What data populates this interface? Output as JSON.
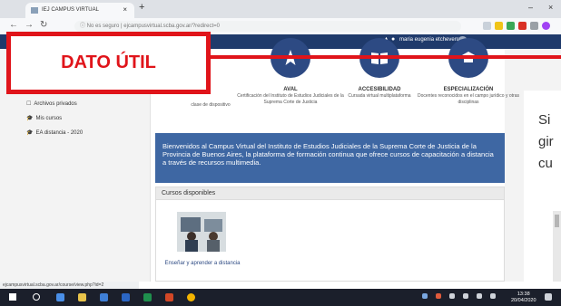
{
  "browser": {
    "tab_title": "IEJ CAMPUS VIRTUAL",
    "tab_close": "×",
    "new_tab": "+",
    "win_min": "–",
    "win_close": "×",
    "address": "ⓘ No es seguro  |  ejcampusvirtual.scba.gov.ar/?redirect=0"
  },
  "site": {
    "user_name": "maria eugenia etcheverr",
    "status_url": "ejcampusvirtual.scba.gov.ar/course/view.php?id=2"
  },
  "nav": {
    "items": [
      {
        "icon": "☐",
        "label": "Archivos privados"
      },
      {
        "icon": "🎓",
        "label": "Mis cursos"
      },
      {
        "icon": "🎓",
        "label": "EA distancia - 2020"
      }
    ]
  },
  "features": [
    {
      "title": "",
      "desc": "clase de dispositivo"
    },
    {
      "title": "AVAL",
      "desc": "Certificación del Instituto de Estudios Judiciales de la Suprema Corte de Justicia"
    },
    {
      "title": "ACCESIBILIDAD",
      "desc": "Cursada virtual multiplataforma"
    },
    {
      "title": "ESPECIALIZACIÓN",
      "desc": "Docentes reconocidos en el campo jurídico y otras disciplinas"
    }
  ],
  "welcome": {
    "text": "Bienvenidos al Campus Virtual del Instituto de Estudios Judiciales de la Suprema Corte de Justicia de la Provincia de Buenos Aires, la plataforma de formación continua que ofrece cursos de capacitación a distancia a través de recursos multimedia."
  },
  "courses": {
    "heading": "Cursos disponibles",
    "items": [
      {
        "name": "Enseñar y aprender a distancia"
      }
    ]
  },
  "side_text": {
    "line1": "Si",
    "line2": "gir",
    "line3": "cu"
  },
  "taskbar": {
    "time": "13:38",
    "date": "20/04/2020"
  },
  "callout": {
    "text": "DATO ÚTIL",
    "color": "#e0141a"
  }
}
